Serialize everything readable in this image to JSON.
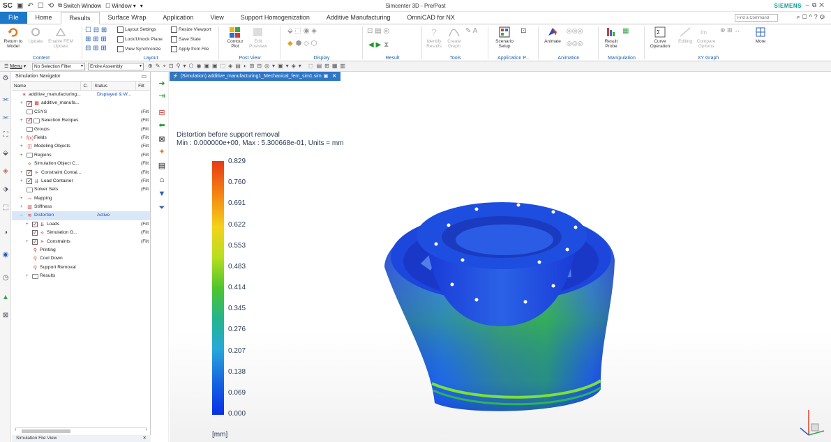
{
  "title_bar": {
    "app_badge": "SC",
    "switch_window": "Switch Window",
    "window_menu": "Window",
    "window_title": "Simcenter 3D - Pre/Post",
    "brand": "SIEMENS"
  },
  "tabs": [
    "File",
    "Home",
    "Results",
    "Surface Wrap",
    "Application",
    "View",
    "Support Homogenization",
    "Additive Manufacturing",
    "OmniCAD for NX"
  ],
  "find_command": "Find a Command",
  "ribbon": {
    "context": {
      "label": "Context",
      "return_model": "Return to Model",
      "update": "Update",
      "enable_fem_update": "Enable FEM Update"
    },
    "layout": {
      "label": "Layout",
      "layout_settings": "Layout Settings",
      "lock_unlock_plane": "Lock/Unlock Plane",
      "view_synchronize": "View Synchronize",
      "resize_viewport": "Resize Viewport",
      "save_state": "Save State",
      "apply_from_file": "Apply from File"
    },
    "post_view": {
      "label": "Post View",
      "contour_plot": "Contour Plot",
      "edit_postview": "Edit Postview"
    },
    "display": {
      "label": "Display"
    },
    "result": {
      "label": "Result"
    },
    "tools": {
      "label": "Tools",
      "identify_results": "Identify Results",
      "create_graph": "Create Graph"
    },
    "application_p": {
      "label": "Application P...",
      "scenario_setup": "Scenario Setup"
    },
    "animation": {
      "label": "Animation",
      "animate": "Animate"
    },
    "manipulation": {
      "label": "Manipulation",
      "result_probe": "Result Probe"
    },
    "xy_graph": {
      "label": "XY Graph",
      "curve_operation": "Curve Operation",
      "editing": "Editing",
      "compare_options": "Compare Options"
    },
    "more": "More"
  },
  "toolbar2": {
    "menu": "Menu",
    "selection_filter": "No Selection Filter",
    "assembly_scope": "Entire Assembly"
  },
  "navigator": {
    "title": "Simulation Navigator",
    "columns": {
      "name": "Name",
      "c": "C.",
      "status": "Status",
      "filter": "Filt"
    },
    "rows": [
      {
        "name": "additive_manufacturing...",
        "status": "Displayed & W...",
        "filter": "",
        "indent": 0,
        "exp": "",
        "checked": false,
        "icon": "sim-file-icon"
      },
      {
        "name": "additive_manufa...",
        "status": "",
        "filter": "",
        "indent": 1,
        "exp": "+",
        "checked": true,
        "icon": "model-icon"
      },
      {
        "name": "CSYS",
        "status": "",
        "filter": "(Filt",
        "indent": 1,
        "exp": "",
        "checked": false,
        "icon": "folder-icon"
      },
      {
        "name": "Selection Recipes",
        "status": "",
        "filter": "(Filt",
        "indent": 1,
        "exp": "+",
        "checked": true,
        "icon": "folder-icon"
      },
      {
        "name": "Groups",
        "status": "",
        "filter": "(Filt",
        "indent": 1,
        "exp": "",
        "checked": false,
        "icon": "folder-icon"
      },
      {
        "name": "Fields",
        "status": "",
        "filter": "(Filt",
        "indent": 1,
        "exp": "+",
        "checked": false,
        "icon": "fields-icon"
      },
      {
        "name": "Modeling Objects",
        "status": "",
        "filter": "(Filt",
        "indent": 1,
        "exp": "+",
        "checked": false,
        "icon": "modeling-icon"
      },
      {
        "name": "Regions",
        "status": "",
        "filter": "(Filt",
        "indent": 1,
        "exp": "+",
        "checked": false,
        "icon": "folder-icon"
      },
      {
        "name": "Simulation Object C...",
        "status": "",
        "filter": "(Filt",
        "indent": 1,
        "exp": "",
        "checked": false,
        "icon": "sim-object-icon"
      },
      {
        "name": "Constraint Contai...",
        "status": "",
        "filter": "(Filt",
        "indent": 1,
        "exp": "+",
        "checked": true,
        "icon": "constraint-icon"
      },
      {
        "name": "Load Container",
        "status": "",
        "filter": "(Filt",
        "indent": 1,
        "exp": "+",
        "checked": true,
        "icon": "load-icon"
      },
      {
        "name": "Solver Sets",
        "status": "",
        "filter": "(Filt",
        "indent": 1,
        "exp": "",
        "checked": false,
        "icon": "folder-icon"
      },
      {
        "name": "Mapping",
        "status": "",
        "filter": "",
        "indent": 1,
        "exp": "+",
        "checked": false,
        "icon": "mapping-icon"
      },
      {
        "name": "Stiffness",
        "status": "",
        "filter": "",
        "indent": 1,
        "exp": "+",
        "checked": false,
        "icon": "stiffness-icon"
      },
      {
        "name": "Distortion",
        "status": "Active",
        "filter": "",
        "indent": 1,
        "exp": "–",
        "checked": false,
        "icon": "distortion-icon",
        "selected": true
      },
      {
        "name": "Loads",
        "status": "",
        "filter": "(Filt",
        "indent": 2,
        "exp": "+",
        "checked": true,
        "icon": "load-icon"
      },
      {
        "name": "Simulation O...",
        "status": "",
        "filter": "(Filt",
        "indent": 2,
        "exp": "",
        "checked": true,
        "icon": "sim-object-icon"
      },
      {
        "name": "Constraints",
        "status": "",
        "filter": "(Filt",
        "indent": 2,
        "exp": "+",
        "checked": true,
        "icon": "constraint-icon"
      },
      {
        "name": "Printing",
        "status": "",
        "filter": "",
        "indent": 2,
        "exp": "",
        "checked": false,
        "icon": "step-icon"
      },
      {
        "name": "Cool Down",
        "status": "",
        "filter": "",
        "indent": 2,
        "exp": "",
        "checked": false,
        "icon": "step-icon"
      },
      {
        "name": "Support Removal",
        "status": "",
        "filter": "",
        "indent": 2,
        "exp": "",
        "checked": false,
        "icon": "step-icon"
      },
      {
        "name": "Results",
        "status": "",
        "filter": "",
        "indent": 2,
        "exp": "+",
        "checked": false,
        "icon": "folder-icon"
      }
    ],
    "bottom_panel": "Simulation File View"
  },
  "graphics": {
    "tab_label": "(Simulation) additive_manufacturing1_Mechanical_fem_sim1.sim",
    "title_line1": "Distortion before support removal",
    "title_line2": "Min : 0.000000e+00, Max : 5.300668e-01, Units = mm",
    "legend_values": [
      "0.829",
      "0.760",
      "0.691",
      "0.622",
      "0.553",
      "0.483",
      "0.414",
      "0.345",
      "0.276",
      "0.207",
      "0.138",
      "0.069",
      "0.000"
    ],
    "legend_colors": [
      "#e8401a",
      "#f6701a",
      "#f79a1c",
      "#f2c51b",
      "#c4d91e",
      "#8fd123",
      "#4fc22b",
      "#2dbb6a",
      "#23b4a4",
      "#22a4d8",
      "#1a7fe0",
      "#1552e2",
      "#0a2fe6"
    ],
    "unit": "[mm]",
    "view_triad": "triad-icon"
  }
}
